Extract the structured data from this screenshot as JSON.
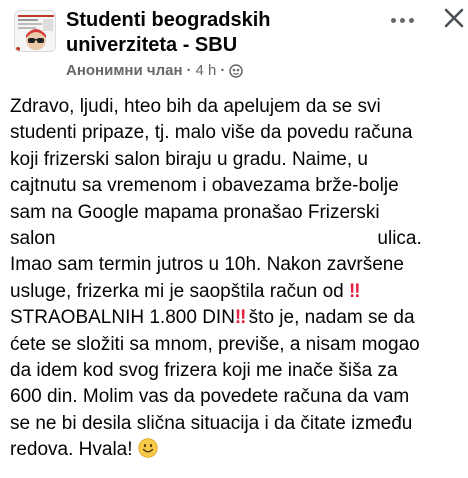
{
  "post": {
    "group_name": "Studenti beogradskih univerziteta - SBU",
    "author": "Анонимни члан",
    "separator": "·",
    "time": "4 h",
    "body_lines": [
      "Zdravo, ljudi, hteo bih da apelujem da se svi",
      "studenti pripaze, tj. malo više da povedu računa",
      "koji frizerski salon biraju u gradu. Naime, u",
      "cajtnutu sa vremenom i obavezama brže-bolje",
      "sam na Google mapama pronašao Frizerski",
      "salon",
      "ulica.",
      "Imao sam termin jutros u 10h. Nakon završene",
      "usluge, frizerka mi je saopštila račun od",
      "STRAOBALNIH 1.800 DIN",
      " što je, nadam se da",
      "ćete se složiti sa mnom, previše, a nisam mogao",
      "da idem kod svog frizera koji me inače šiša za",
      "600 din. Molim vas da povedete računa da vam",
      "se ne bi desila slična situacija i da čitate između",
      "redova. Hvala!"
    ],
    "double_exclamation": "‼",
    "icons": {
      "audience": "globe-icon",
      "more": "more-options-icon",
      "close": "close-icon",
      "emoji": "smiling-face-icon"
    },
    "colors": {
      "text": "#050505",
      "meta": "#65676b",
      "alert": "#e41e3f"
    }
  }
}
